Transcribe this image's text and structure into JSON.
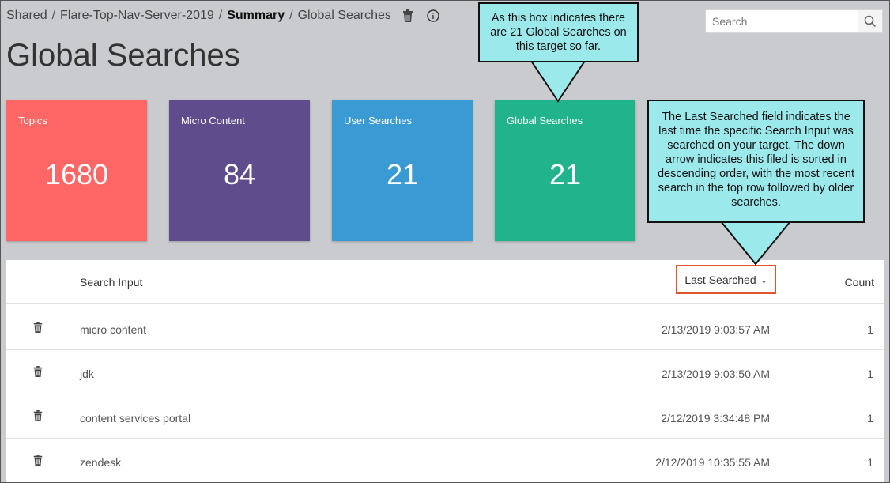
{
  "breadcrumb": {
    "part1": "Shared",
    "sep": "/",
    "part2": "Flare-Top-Nav-Server-2019",
    "part3": "Summary",
    "part4": "Global Searches"
  },
  "page_title": "Global Searches",
  "search": {
    "placeholder": "Search"
  },
  "cards": [
    {
      "label": "Topics",
      "value": "1680",
      "color": "#ff6766"
    },
    {
      "label": "Micro Content",
      "value": "84",
      "color": "#5f4c8c"
    },
    {
      "label": "User Searches",
      "value": "21",
      "color": "#3a9ad3"
    },
    {
      "label": "Global Searches",
      "value": "21",
      "color": "#21b38c"
    }
  ],
  "table": {
    "headers": {
      "input": "Search Input",
      "last_searched": "Last Searched",
      "sort_arrow": "↓",
      "count": "Count"
    },
    "rows": [
      {
        "input": "micro content",
        "date": "2/13/2019 9:03:57 AM",
        "count": "1"
      },
      {
        "input": "jdk",
        "date": "2/13/2019 9:03:50 AM",
        "count": "1"
      },
      {
        "input": "content services portal",
        "date": "2/12/2019 3:34:48 PM",
        "count": "1"
      },
      {
        "input": "zendesk",
        "date": "2/12/2019 10:35:55 AM",
        "count": "1"
      }
    ]
  },
  "callouts": {
    "global": "As this box indicates there are 21 Global Searches on this target so far.",
    "last_searched": "The Last Searched field indicates the last time the specific Search Input was searched on your target. The down arrow indicates this filed is sorted in descending order, with the most recent search in the top row followed by older searches."
  },
  "colors": {
    "callout_bg": "#9ce9ec",
    "highlight_border": "#e0542d",
    "background": "#c9cbce"
  },
  "icons": [
    "trash-icon",
    "info-icon",
    "search-icon"
  ]
}
